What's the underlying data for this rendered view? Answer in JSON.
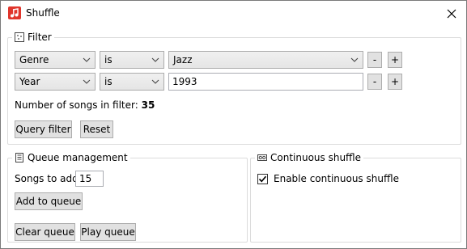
{
  "window": {
    "title": "Shuffle",
    "close_icon": "close-icon",
    "app_icon": "music-note-icon"
  },
  "filter": {
    "header": "Filter",
    "icon": "filter-icon",
    "rows": [
      {
        "field": "Genre",
        "operator": "is",
        "value": "Jazz",
        "value_type": "combo"
      },
      {
        "field": "Year",
        "operator": "is",
        "value": "1993",
        "value_type": "text"
      }
    ],
    "remove_label": "-",
    "add_label": "+",
    "count_label": "Number of songs in filter:",
    "count_value": "35",
    "query_button": "Query filter",
    "reset_button": "Reset"
  },
  "queue": {
    "header": "Queue management",
    "icon": "document-icon",
    "songs_to_add_label": "Songs to add",
    "songs_to_add_value": "15",
    "add_button": "Add to queue",
    "clear_button": "Clear queue",
    "play_button": "Play queue"
  },
  "continuous": {
    "header": "Continuous shuffle",
    "icon": "infinity-icon",
    "enable_label": "Enable continuous shuffle",
    "enabled": true
  },
  "colors": {
    "app_icon": "#e0362c",
    "border": "#dcdcdc",
    "button_bg": "#e1e1e1"
  }
}
